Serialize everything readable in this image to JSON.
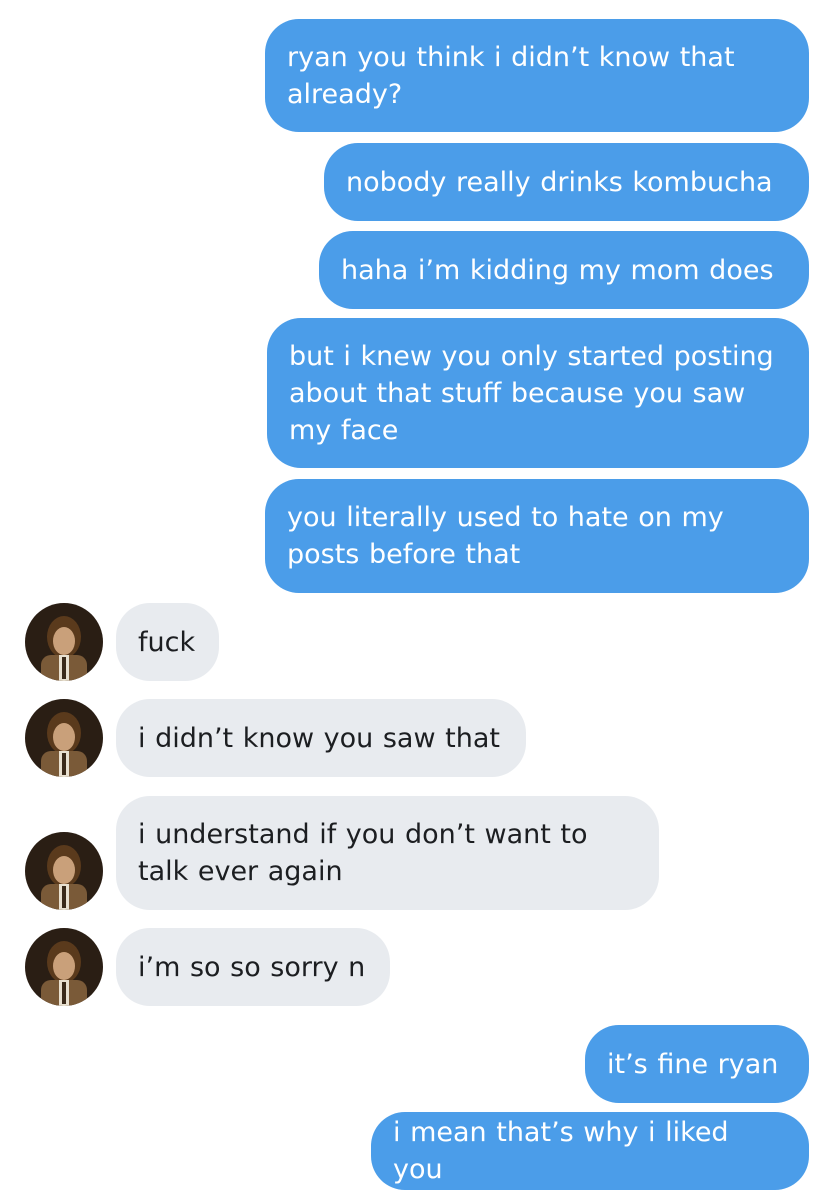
{
  "conversation": {
    "messages": [
      {
        "side": "out",
        "text": "ryan you think i didn’t know that\nalready?"
      },
      {
        "side": "out",
        "text": "nobody really drinks kombucha"
      },
      {
        "side": "out",
        "text": "haha i’m kidding my mom does"
      },
      {
        "side": "out",
        "text": "but i knew you only started posting\nabout that stuff because you saw\nmy face"
      },
      {
        "side": "out",
        "text": "you literally used to hate on my\nposts before that"
      },
      {
        "side": "in",
        "text": "fuck"
      },
      {
        "side": "in",
        "text": "i didn’t know you saw that"
      },
      {
        "side": "in",
        "text": "i understand if you don’t want to\ntalk ever again"
      },
      {
        "side": "in",
        "text": "i’m so so sorry n"
      },
      {
        "side": "out",
        "text": "it’s fine ryan"
      },
      {
        "side": "out",
        "text": "i mean that’s why i liked you"
      }
    ]
  },
  "colors": {
    "outgoing_bubble": "#4b9de9",
    "incoming_bubble": "#e8ebef",
    "outgoing_text": "#ffffff",
    "incoming_text": "#1c1e21"
  },
  "icons": {
    "avatar": "contact-avatar-photo"
  }
}
